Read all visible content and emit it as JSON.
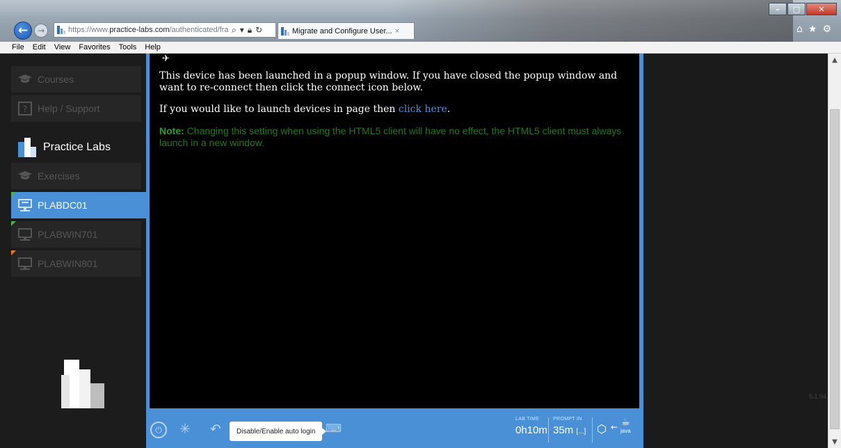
{
  "browser": {
    "url_prefix": "https://www.",
    "url_domain": "practice-labs.com",
    "url_rest": "/authenticated/fra",
    "tab_title": "Migrate and Configure User...",
    "tab_close": "×",
    "icons": [
      "back-arrow-icon",
      "forward-arrow-icon",
      "search-icon",
      "lock-icon",
      "refresh-icon",
      "home-icon",
      "favorites-star-icon",
      "settings-gear-icon"
    ],
    "window_buttons": {
      "minimize": "–",
      "maximize": "□",
      "close": "✕"
    }
  },
  "menubar": [
    "File",
    "Edit",
    "View",
    "Favorites",
    "Tools",
    "Help"
  ],
  "sidebar": {
    "top_items": [
      {
        "label": "Courses",
        "icon": "graduation-cap-icon"
      },
      {
        "label": "Help / Support",
        "icon": "help-question-icon"
      }
    ],
    "brand": "Practice Labs",
    "exercises": {
      "label": "Exercises",
      "icon": "graduation-cap-icon"
    },
    "devices": [
      {
        "label": "PLABDC01",
        "status": "green",
        "active": true
      },
      {
        "label": "PLABWIN701",
        "status": "green",
        "active": false
      },
      {
        "label": "PLABWIN801",
        "status": "orange",
        "active": false
      }
    ]
  },
  "content": {
    "message1": "This device has been launched in a popup window. If you have closed the popup window and want to re-connect then click the connect icon below.",
    "message2_prefix": "If you would like to launch devices in page then ",
    "message2_link": "click here",
    "message2_suffix": ".",
    "note_label": "Note:",
    "note_text": " Changing this setting when using the HTML5 client will have no effect, the HTML5 client must always launch in a new window."
  },
  "toolbar": {
    "tooltip": "Disable/Enable auto login",
    "lab_time_label": "LAB TIME",
    "lab_time_value": "0h10m",
    "prompt_label": "PROMPT IN",
    "prompt_value": "35m",
    "prompt_more": "[...]",
    "java_label": "java"
  },
  "version": "5.1.94",
  "colors": {
    "accent": "#4a90d6",
    "note_green": "#1c7a1c",
    "status_green": "#4caf50",
    "status_orange": "#e67e22"
  }
}
